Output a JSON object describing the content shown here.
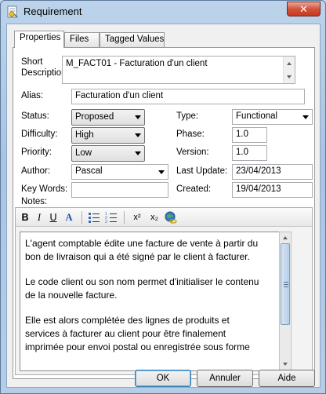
{
  "window": {
    "title": "Requirement",
    "close_symbol": "✕"
  },
  "tabs": [
    {
      "label": "Properties",
      "active": true
    },
    {
      "label": "Files",
      "active": false
    },
    {
      "label": "Tagged Values",
      "active": false
    }
  ],
  "form": {
    "short_description_label_1": "Short",
    "short_description_label_2": "Description:",
    "short_description_value": "M_FACT01 - Facturation d'un client",
    "alias_label": "Alias:",
    "alias_value": "Facturation d'un client",
    "status_label": "Status:",
    "status_value": "Proposed",
    "difficulty_label": "Difficulty:",
    "difficulty_value": "High",
    "priority_label": "Priority:",
    "priority_value": "Low",
    "author_label": "Author:",
    "author_value": "Pascal",
    "key_words_label": "Key Words:",
    "key_words_value": "",
    "type_label": "Type:",
    "type_value": "Functional",
    "phase_label": "Phase:",
    "phase_value": "1.0",
    "version_label": "Version:",
    "version_value": "1.0",
    "last_update_label": "Last Update:",
    "last_update_value": "23/04/2013",
    "created_label": "Created:",
    "created_value": "19/04/2013",
    "notes_label": "Notes:"
  },
  "toolbar": {
    "bold": "B",
    "italic": "I",
    "underline": "U",
    "font_color": "A",
    "superscript": "x²",
    "subscript": "x₂"
  },
  "notes": {
    "paragraphs": [
      "L'agent comptable édite une facture de vente à partir du bon de livraison qui a été signé par le client à facturer.",
      "Le code client ou son nom permet d'initialiser le contenu de la nouvelle facture.",
      "Elle est alors complétée des lignes de produits et services à facturer au client pour être finalement imprimée pour envoi postal ou enregistrée sous forme"
    ]
  },
  "buttons": {
    "ok": "OK",
    "cancel": "Annuler",
    "help": "Aide"
  },
  "colors": {
    "accent": "#3c7fb1",
    "close": "#c43a20",
    "misspell": "#e02020"
  }
}
